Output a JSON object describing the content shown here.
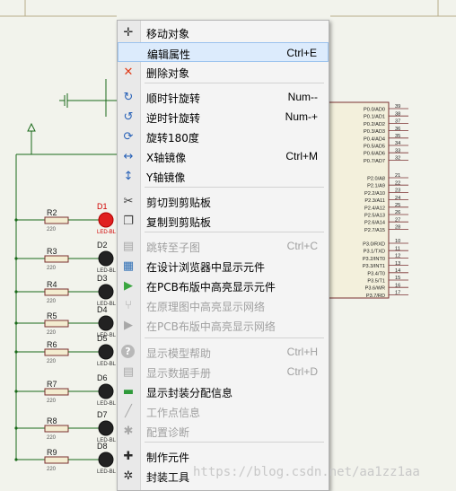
{
  "menu": {
    "items": [
      {
        "label": "移动对象",
        "shortcut": "",
        "icon": "move-icon",
        "glyph": "✛",
        "color": "#2b2b2b",
        "disabled": false,
        "highlight": false
      },
      {
        "label": "编辑属性",
        "shortcut": "Ctrl+E",
        "icon": "edit-properties-icon",
        "glyph": "",
        "color": "#2b2b2b",
        "disabled": false,
        "highlight": true
      },
      {
        "label": "删除对象",
        "shortcut": "",
        "icon": "delete-icon",
        "glyph": "✕",
        "color": "#e03c1a",
        "disabled": false,
        "highlight": false
      },
      {
        "label": "顺时针旋转",
        "shortcut": "Num--",
        "icon": "rotate-clockwise-icon",
        "glyph": "↻",
        "color": "#2a63b8",
        "disabled": false,
        "highlight": false
      },
      {
        "label": "逆时针旋转",
        "shortcut": "Num-+",
        "icon": "rotate-anticlockwise-icon",
        "glyph": "↺",
        "color": "#2a63b8",
        "disabled": false,
        "highlight": false
      },
      {
        "label": "旋转180度",
        "shortcut": "",
        "icon": "rotate-180-icon",
        "glyph": "⟳",
        "color": "#2a63b8",
        "disabled": false,
        "highlight": false
      },
      {
        "label": "X轴镜像",
        "shortcut": "Ctrl+M",
        "icon": "mirror-x-icon",
        "glyph": "↔",
        "color": "#2a63b8",
        "disabled": false,
        "highlight": false
      },
      {
        "label": "Y轴镜像",
        "shortcut": "",
        "icon": "mirror-y-icon",
        "glyph": "↕",
        "color": "#2a63b8",
        "disabled": false,
        "highlight": false
      },
      {
        "label": "剪切到剪贴板",
        "shortcut": "",
        "icon": "scissors-icon",
        "glyph": "✂",
        "color": "#3a3a3a",
        "disabled": false,
        "highlight": false
      },
      {
        "label": "复制到剪贴板",
        "shortcut": "",
        "icon": "copy-icon",
        "glyph": "❐",
        "color": "#3a3a3a",
        "disabled": false,
        "highlight": false
      },
      {
        "label": "跳转至子图",
        "shortcut": "Ctrl+C",
        "icon": "goto-child-sheet-icon",
        "glyph": "▤",
        "color": "#a8a8a8",
        "disabled": true,
        "highlight": false
      },
      {
        "label": "在设计浏览器中显示元件",
        "shortcut": "",
        "icon": "design-explorer-icon",
        "glyph": "▦",
        "color": "#2f6fb5",
        "disabled": false,
        "highlight": false
      },
      {
        "label": "在PCB布版中高亮显示元件",
        "shortcut": "",
        "icon": "pcb-highlight-icon",
        "glyph": "▶",
        "color": "#3aa640",
        "disabled": false,
        "highlight": false
      },
      {
        "label": "在原理图中高亮显示网络",
        "shortcut": "",
        "icon": "schematic-net-icon",
        "glyph": "⑂",
        "color": "#a8a8a8",
        "disabled": true,
        "highlight": false
      },
      {
        "label": "在PCB布版中高亮显示网络",
        "shortcut": "",
        "icon": "pcb-net-icon",
        "glyph": "▶",
        "color": "#a8a8a8",
        "disabled": true,
        "highlight": false
      },
      {
        "label": "显示模型帮助",
        "shortcut": "Ctrl+H",
        "icon": "help-icon",
        "glyph": "?",
        "color": "#ffffff",
        "disabled": true,
        "highlight": false
      },
      {
        "label": "显示数据手册",
        "shortcut": "Ctrl+D",
        "icon": "datasheet-icon",
        "glyph": "▤",
        "color": "#a8a8a8",
        "disabled": true,
        "highlight": false
      },
      {
        "label": "显示封装分配信息",
        "shortcut": "",
        "icon": "package-icon",
        "glyph": "▬",
        "color": "#2f9a3a",
        "disabled": false,
        "highlight": false
      },
      {
        "label": "工作点信息",
        "shortcut": "",
        "icon": "operating-point-icon",
        "glyph": "╱",
        "color": "#a8a8a8",
        "disabled": true,
        "highlight": false
      },
      {
        "label": "配置诊断",
        "shortcut": "",
        "icon": "bug-icon",
        "glyph": "✱",
        "color": "#a8a8a8",
        "disabled": true,
        "highlight": false
      },
      {
        "label": "制作元件",
        "shortcut": "",
        "icon": "make-device-icon",
        "glyph": "✚",
        "color": "#2b2b2b",
        "disabled": false,
        "highlight": false
      },
      {
        "label": "封装工具",
        "shortcut": "",
        "icon": "package-tool-icon",
        "glyph": "✲",
        "color": "#2b2b2b",
        "disabled": false,
        "highlight": false
      }
    ]
  },
  "schematic": {
    "resistors": [
      {
        "ref": "R2",
        "value": "220"
      },
      {
        "ref": "R3",
        "value": "220"
      },
      {
        "ref": "R4",
        "value": "220"
      },
      {
        "ref": "R5",
        "value": "220"
      },
      {
        "ref": "R6",
        "value": "220"
      },
      {
        "ref": "R7",
        "value": "220"
      },
      {
        "ref": "R8",
        "value": "220"
      },
      {
        "ref": "R9",
        "value": "220"
      }
    ],
    "leds": [
      {
        "ref": "D1",
        "type": "LED-BL"
      },
      {
        "ref": "D2",
        "type": "LED-BL"
      },
      {
        "ref": "D3",
        "type": "LED-BL"
      },
      {
        "ref": "D4",
        "type": "LED-BL"
      },
      {
        "ref": "D5",
        "type": "LED-BL"
      },
      {
        "ref": "D6",
        "type": "LED-BL"
      },
      {
        "ref": "D7",
        "type": "LED-BL"
      },
      {
        "ref": "D8",
        "type": "LED-BL"
      }
    ],
    "port0": [
      "P0.0/AD0",
      "P0.1/AD1",
      "P0.2/AD2",
      "P0.3/AD3",
      "P0.4/AD4",
      "P0.5/AD5",
      "P0.6/AD6",
      "P0.7/AD7"
    ],
    "port0_pins": [
      "39",
      "38",
      "37",
      "36",
      "35",
      "34",
      "33",
      "32"
    ],
    "port2": [
      "P2.0/A8",
      "P2.1/A9",
      "P2.2/A10",
      "P2.3/A11",
      "P2.4/A12",
      "P2.5/A13",
      "P2.6/A14",
      "P2.7/A15"
    ],
    "port2_pins": [
      "21",
      "22",
      "23",
      "24",
      "25",
      "26",
      "27",
      "28"
    ],
    "port3": [
      "P3.0/RXD",
      "P3.1/TXD",
      "P3.2/INT0",
      "P3.3/INT1",
      "P3.4/T0",
      "P3.5/T1",
      "P3.6/WR",
      "P3.7/RD"
    ],
    "port3_pins": [
      "10",
      "11",
      "12",
      "13",
      "14",
      "15",
      "16",
      "17"
    ]
  },
  "watermark": "https://blog.csdn.net/aa1zz1aa"
}
